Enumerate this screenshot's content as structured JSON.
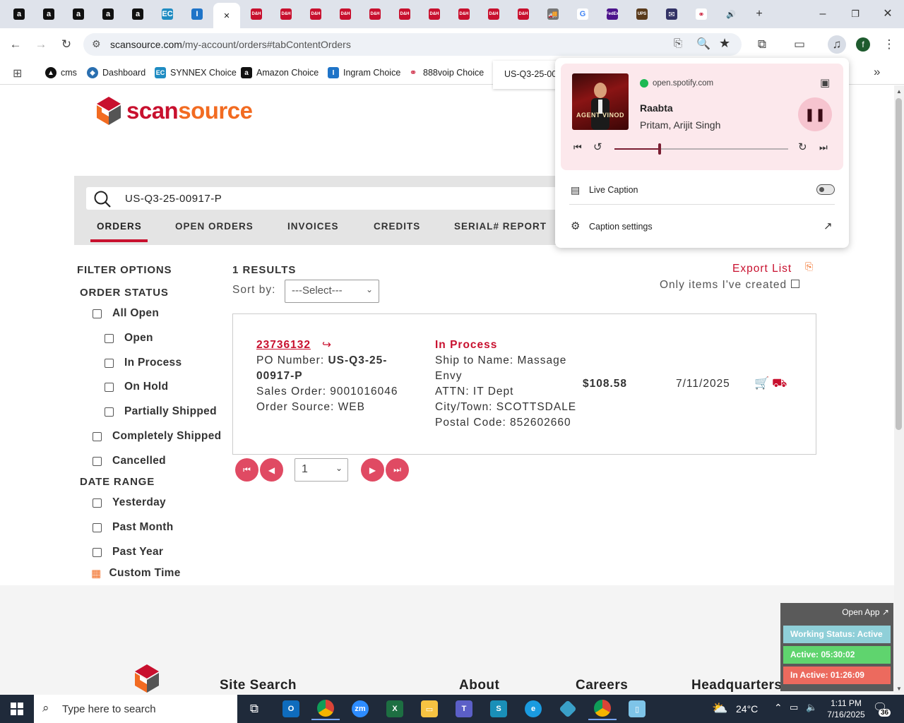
{
  "browser": {
    "tabs": [
      {
        "icon": "amazon-icon",
        "glyph": "a"
      },
      {
        "icon": "amazon-icon",
        "glyph": "a"
      },
      {
        "icon": "amazon-icon",
        "glyph": "a"
      },
      {
        "icon": "amazon-icon",
        "glyph": "a"
      },
      {
        "icon": "amazon-icon",
        "glyph": "a"
      },
      {
        "icon": "ec-icon",
        "glyph": "EC"
      },
      {
        "icon": "ingram-icon",
        "glyph": "I"
      },
      {
        "icon": "close-icon",
        "glyph": "✕"
      },
      {
        "icon": "dh-icon",
        "glyph": "D&H"
      },
      {
        "icon": "dh-icon",
        "glyph": "D&H"
      },
      {
        "icon": "dh-icon",
        "glyph": "D&H"
      },
      {
        "icon": "dh-icon",
        "glyph": "D&H"
      },
      {
        "icon": "dh-icon",
        "glyph": "D&H"
      },
      {
        "icon": "dh-icon",
        "glyph": "D&H"
      },
      {
        "icon": "dh-icon",
        "glyph": "D&H"
      },
      {
        "icon": "dh-icon",
        "glyph": "D&H"
      },
      {
        "icon": "dh-icon",
        "glyph": "D&H"
      },
      {
        "icon": "dh-icon",
        "glyph": "D&H"
      },
      {
        "icon": "truck-icon",
        "glyph": "🚚"
      },
      {
        "icon": "google-icon",
        "glyph": "G"
      },
      {
        "icon": "fedex-icon",
        "glyph": "FedEx"
      },
      {
        "icon": "ups-icon",
        "glyph": "UPS"
      },
      {
        "icon": "usps-icon",
        "glyph": "✉"
      },
      {
        "icon": "888voip-icon",
        "glyph": "⚭"
      },
      {
        "icon": "speaker-icon",
        "glyph": "🔊"
      }
    ],
    "url_domain": "scansource.com",
    "url_path": "/my-account/orders#tabContentOrders",
    "profile_initial": "f",
    "bookmarks": [
      {
        "label": "cms",
        "icon": "cms-icon"
      },
      {
        "label": "Dashboard",
        "icon": "dashboard-icon"
      },
      {
        "label": "SYNNEX Choice",
        "icon": "ec-icon"
      },
      {
        "label": "Amazon Choice",
        "icon": "amazon-icon"
      },
      {
        "label": "Ingram Choice",
        "icon": "ingram-icon"
      },
      {
        "label": "888voip Choice",
        "icon": "888voip-icon"
      }
    ],
    "hover_tab_title": "US-Q3-25-00"
  },
  "media_popup": {
    "source": "open.spotify.com",
    "track": "Raabta",
    "artist": "Pritam, Arijit Singh",
    "album_art_text": "AGENT VINOD",
    "progress": 0.26,
    "live_caption_label": "Live Caption",
    "caption_settings_label": "Caption settings"
  },
  "site": {
    "logo_text": "scansource",
    "search_value": "US-Q3-25-00917-P",
    "tabs": [
      "ORDERS",
      "OPEN ORDERS",
      "INVOICES",
      "CREDITS",
      "SERIAL# REPORT"
    ],
    "filter_title": "FILTER OPTIONS",
    "order_status_title": "ORDER STATUS",
    "status_options": [
      "All Open",
      "Open",
      "In Process",
      "On Hold",
      "Partially Shipped",
      "Completely Shipped",
      "Cancelled"
    ],
    "date_range_title": "DATE RANGE",
    "date_options": [
      "Yesterday",
      "Past Month",
      "Past Year"
    ],
    "custom_time": "Custom Time",
    "results": "1 RESULTS",
    "sort_label": "Sort by:",
    "sort_value": "---Select---",
    "export": "Export List",
    "only_mine": "Only items I've created",
    "order": {
      "number": "23736132",
      "po_label": "PO Number:",
      "po_value": "US-Q3-25-",
      "po_value2": "00917-P",
      "sales_order": "Sales Order: 9001016046",
      "source": "Order Source: WEB",
      "status": "In Process",
      "ship_to": "Ship to Name: Massage",
      "ship_to2": "Envy",
      "attn": "ATTN: IT Dept",
      "city": "City/Town: SCOTTSDALE",
      "postal": "Postal Code: 852602660",
      "amount": "$108.58",
      "date": "7/11/2025"
    },
    "page_value": "1",
    "footer": [
      "Site Search",
      "About",
      "Careers",
      "Headquarters"
    ]
  },
  "tracker": {
    "open_app": "Open App ↗",
    "working": "Working Status: Active",
    "active": "Active: 05:30:02",
    "inactive": "In Active: 01:26:09"
  },
  "taskbar": {
    "search_placeholder": "Type here to search",
    "temperature": "24°C",
    "time": "1:11 PM",
    "date": "7/16/2025",
    "notification_count": "36"
  },
  "colors": {
    "brand_red": "#c8102e",
    "brand_orange": "#f26b21",
    "pager_pink": "#e04a63"
  }
}
